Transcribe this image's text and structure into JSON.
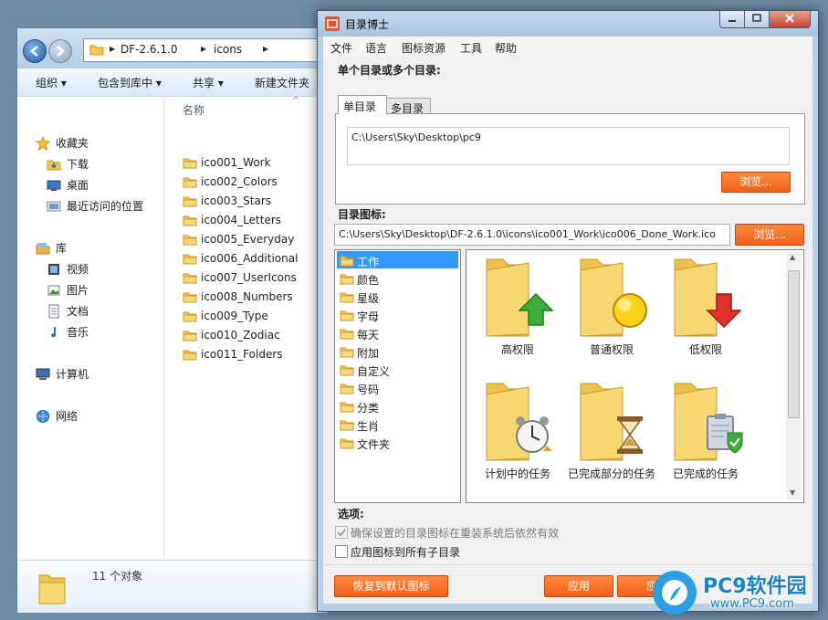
{
  "explorer": {
    "breadcrumb": [
      "DF-2.6.1.0",
      "icons"
    ],
    "toolbar": [
      "组织",
      "包含到库中",
      "共享",
      "新建文件夹"
    ],
    "nav": {
      "favorites": "收藏夹",
      "favorites_items": [
        "下载",
        "桌面",
        "最近访问的位置"
      ],
      "libraries": "库",
      "library_items": [
        "视频",
        "图片",
        "文档",
        "音乐"
      ],
      "computer": "计算机",
      "network": "网络"
    },
    "column_name": "名称",
    "files": [
      "ico001_Work",
      "ico002_Colors",
      "ico003_Stars",
      "ico004_Letters",
      "ico005_Everyday",
      "ico006_Additional",
      "ico007_UserIcons",
      "ico008_Numbers",
      "ico009_Type",
      "ico010_Zodiac",
      "ico011_Folders"
    ],
    "item_count": "11 个对象"
  },
  "dialog": {
    "title": "目录博士",
    "menu": [
      "文件",
      "语言",
      "图标资源",
      "工具",
      "帮助"
    ],
    "dirs_label": "单个目录或多个目录:",
    "tabs": [
      "单目录",
      "多目录"
    ],
    "dir_path": "C:\\Users\\Sky\\Desktop\\pc9",
    "browse": "浏览...",
    "icon_label": "目录图标:",
    "icon_path": "C:\\Users\\Sky\\Desktop\\DF-2.6.1.0\\icons\\ico001_Work\\ico006_Done_Work.ico",
    "categories": [
      "工作",
      "颜色",
      "星级",
      "字母",
      "每天",
      "附加",
      "自定义",
      "号码",
      "分类",
      "生肖",
      "文件夹"
    ],
    "selected_category": "工作",
    "icons": [
      {
        "label": "高权限",
        "badge": "green-up-arrow"
      },
      {
        "label": "普通权限",
        "badge": "yellow-circle"
      },
      {
        "label": "低权限",
        "badge": "red-down-arrow"
      },
      {
        "label": "计划中的任务",
        "badge": "alarm-clock"
      },
      {
        "label": "已完成部分的任务",
        "badge": "hourglass"
      },
      {
        "label": "已完成的任务",
        "badge": "clipboard-check"
      }
    ],
    "options_label": "选项:",
    "option1": "确保设置的目录图标在重装系统后依然有效",
    "option2": "应用图标到所有子目录",
    "restore_default": "恢复到默认图标",
    "apply": "应用",
    "apply2": "应"
  },
  "watermark": {
    "brand": "PC9软件园",
    "url": "www.PC9.com"
  },
  "colors": {
    "accent_orange": "#f0601a",
    "selection_blue": "#3399ff",
    "folder_yellow": "#f5c84a"
  }
}
